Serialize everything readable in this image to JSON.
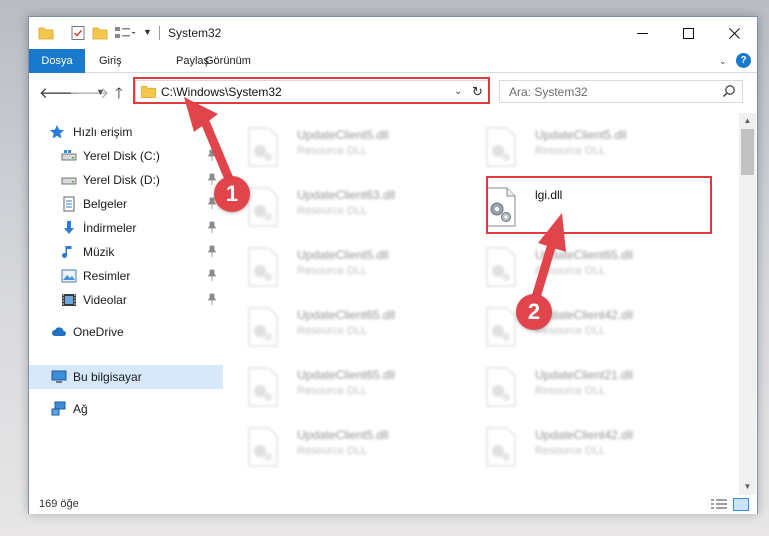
{
  "window": {
    "title": "System32"
  },
  "ribbon": {
    "tabs": [
      {
        "label": "Dosya"
      },
      {
        "label": "Giriş"
      },
      {
        "label": "Paylaş"
      },
      {
        "label": "Görünüm"
      }
    ],
    "help": "?"
  },
  "navbar": {
    "address": "C:\\Windows\\System32",
    "search_placeholder": "Ara: System32"
  },
  "sidebar": {
    "items": [
      {
        "label": "Hızlı erişim",
        "icon": "star-icon"
      },
      {
        "label": "Yerel Disk (C:)",
        "icon": "drive-icon"
      },
      {
        "label": "Yerel Disk (D:)",
        "icon": "drive-icon"
      },
      {
        "label": "Belgeler",
        "icon": "documents-icon"
      },
      {
        "label": "İndirmeler",
        "icon": "download-icon"
      },
      {
        "label": "Müzik",
        "icon": "music-icon"
      },
      {
        "label": "Resimler",
        "icon": "pictures-icon"
      },
      {
        "label": "Videolar",
        "icon": "videos-icon"
      },
      {
        "label": "OneDrive",
        "icon": "cloud-icon"
      },
      {
        "label": "Bu bilgisayar",
        "icon": "computer-icon"
      },
      {
        "label": "Ağ",
        "icon": "network-icon"
      }
    ],
    "selected": "Bu bilgisayar"
  },
  "files": [
    {
      "name": "UpdateClient5.dll",
      "type": "Resource DLL"
    },
    {
      "name": "UpdateClient5.dll",
      "type": "Resource DLL"
    },
    {
      "name": "UpdateClient63.dll",
      "type": "Resource DLL"
    },
    {
      "name": "lgi.dll",
      "type": ""
    },
    {
      "name": "UpdateClient5.dll",
      "type": "Resource DLL"
    },
    {
      "name": "UpdateClient65.dll",
      "type": "Resource DLL"
    },
    {
      "name": "UpdateClient65.dll",
      "type": "Resource DLL"
    },
    {
      "name": "UpdateClient42.dll",
      "type": "Resource DLL"
    },
    {
      "name": "UpdateClient65.dll",
      "type": "Resource DLL"
    },
    {
      "name": "UpdateClient21.dll",
      "type": "Resource DLL"
    },
    {
      "name": "UpdateClient5.dll",
      "type": "Resource DLL"
    },
    {
      "name": "UpdateClient42.dll",
      "type": "Resource DLL"
    }
  ],
  "status": {
    "count": "169 öğe"
  },
  "annotations": {
    "step1": "1",
    "step2": "2",
    "color": "#e03a40"
  },
  "colors": {
    "accent": "#1979ca",
    "selected_bg": "#d6e8fa"
  }
}
